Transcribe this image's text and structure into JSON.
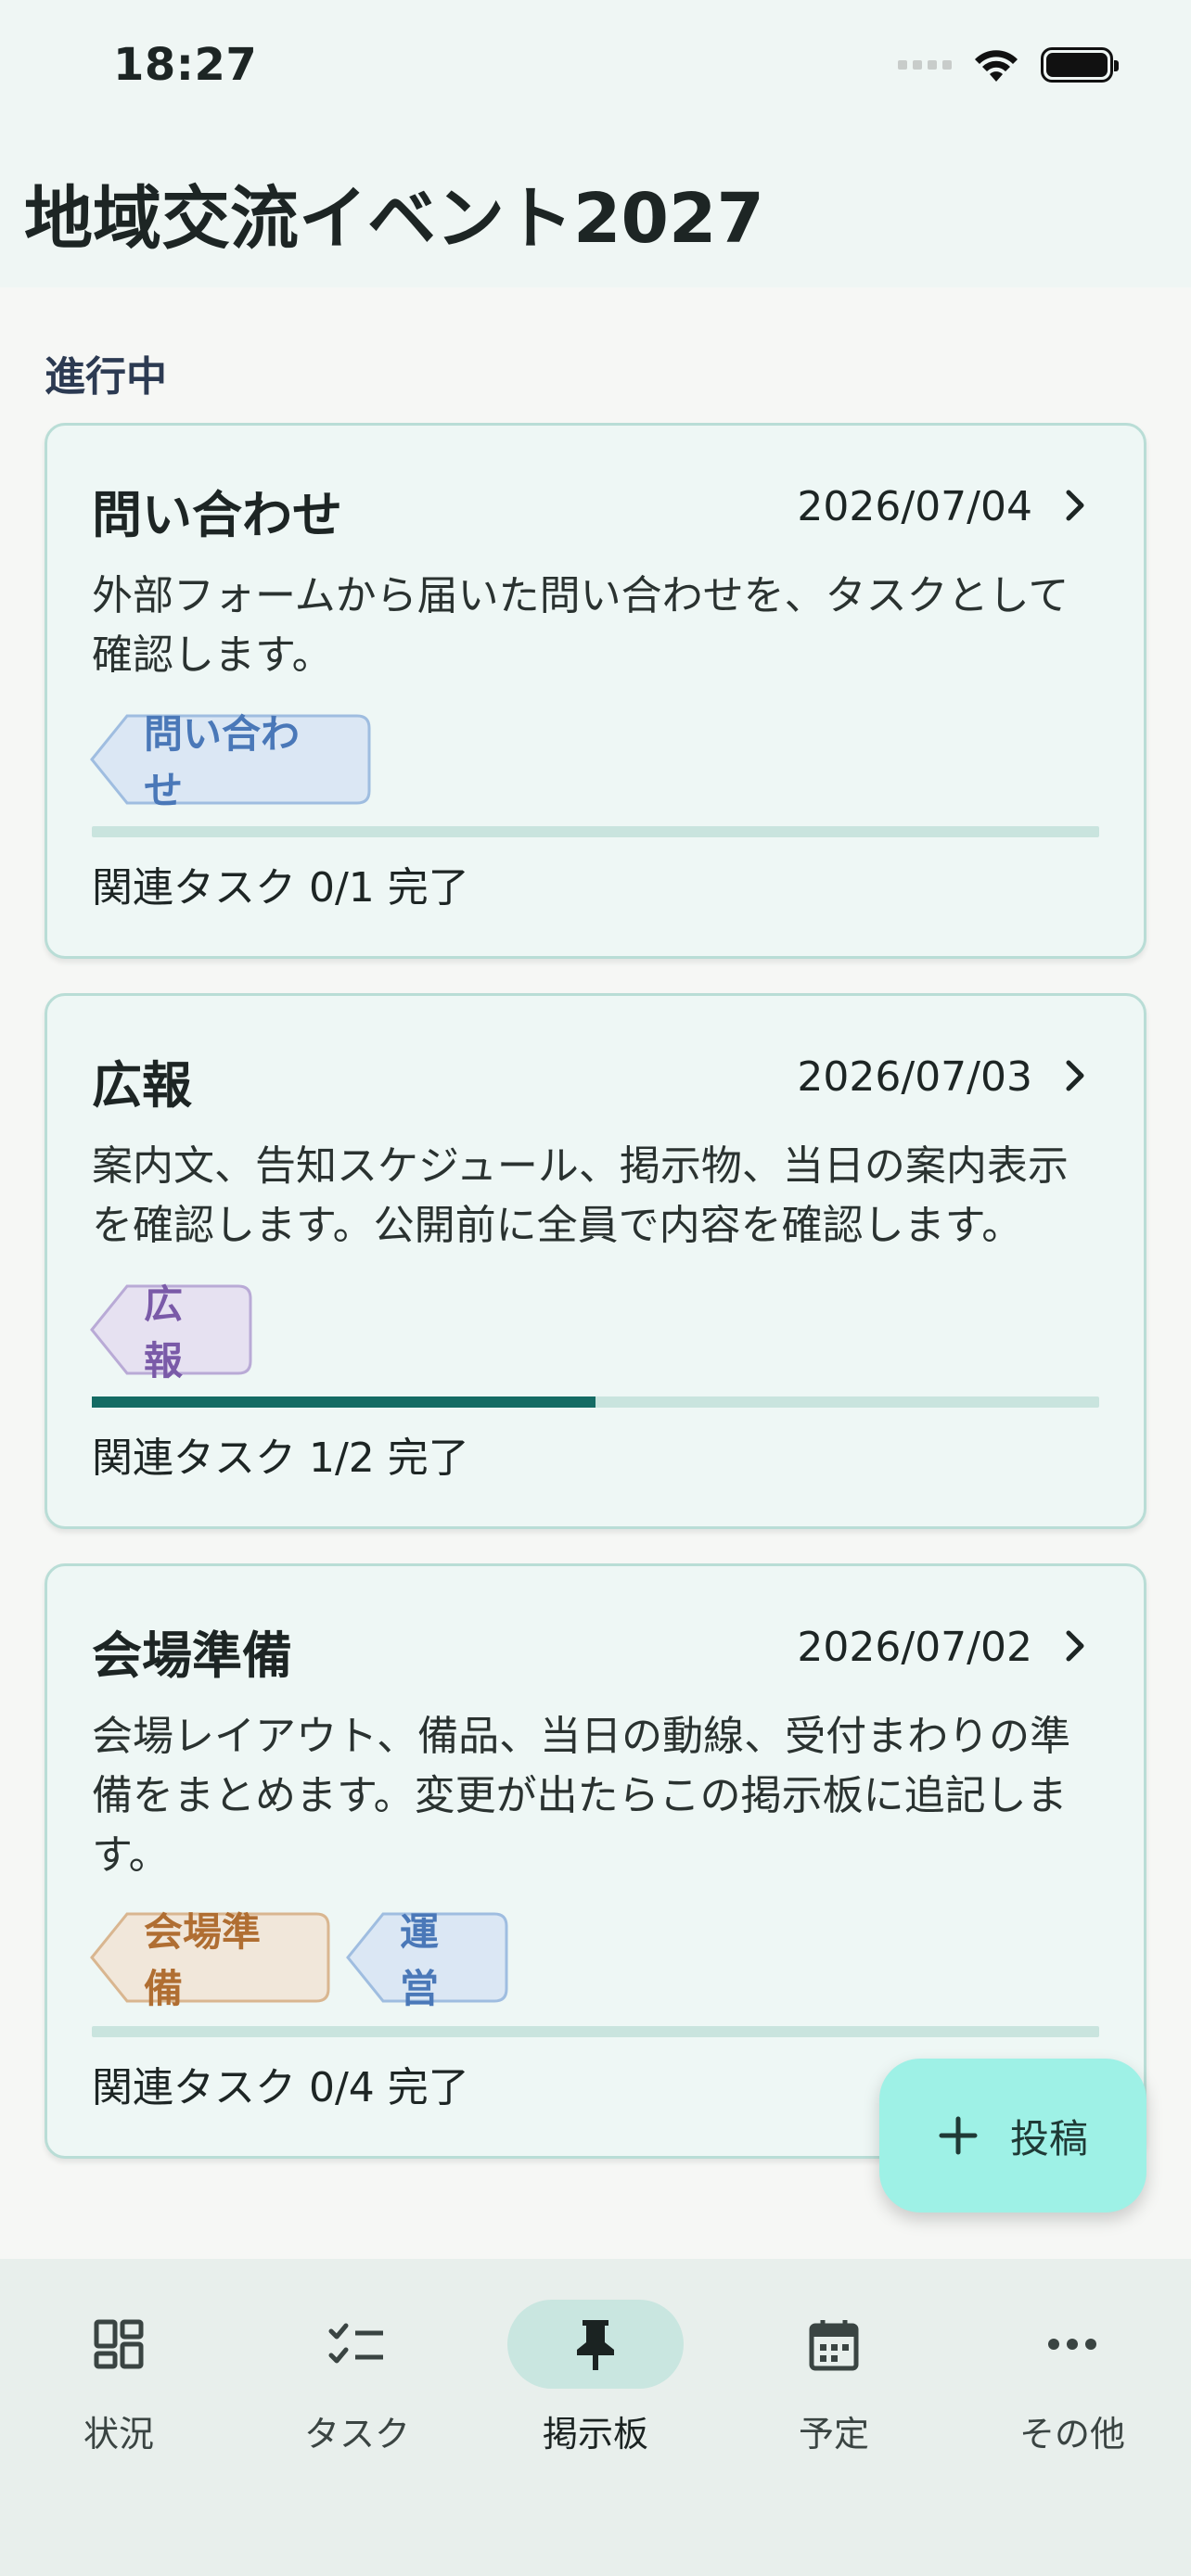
{
  "status_bar": {
    "time": "18:27"
  },
  "app": {
    "title": "地域交流イベント2027"
  },
  "section": {
    "label": "進行中"
  },
  "cards": [
    {
      "title": "問い合わせ",
      "date": "2026/07/04",
      "body": "外部フォームから届いた問い合わせを、タスクとして確認します。",
      "tags": [
        {
          "label": "問い合わせ",
          "color": "#4a78b8",
          "bg": "#dbe7f4",
          "border": "#9fbde0"
        }
      ],
      "progress": 0,
      "count": "関連タスク 0/1 完了"
    },
    {
      "title": "広報",
      "date": "2026/07/03",
      "body": "案内文、告知スケジュール、掲示物、当日の案内表示を確認します。公開前に全員で内容を確認します。",
      "tags": [
        {
          "label": "広報",
          "color": "#7a5aa8",
          "bg": "#e6e1f1",
          "border": "#b9aad6"
        }
      ],
      "progress": 0.5,
      "count": "関連タスク 1/2 完了"
    },
    {
      "title": "会場準備",
      "date": "2026/07/02",
      "body": "会場レイアウト、備品、当日の動線、受付まわりの準備をまとめます。変更が出たらこの掲示板に追記します。",
      "tags": [
        {
          "label": "会場準備",
          "color": "#b06e32",
          "bg": "#f1e7da",
          "border": "#d9b690"
        },
        {
          "label": "運営",
          "color": "#4a78b8",
          "bg": "#dbe7f4",
          "border": "#9fbde0"
        }
      ],
      "progress": 0,
      "count": "関連タスク 0/4 完了"
    }
  ],
  "fab": {
    "label": "投稿",
    "icon": "plus-icon"
  },
  "nav": [
    {
      "label": "状況",
      "icon": "dashboard-icon",
      "active": false
    },
    {
      "label": "タスク",
      "icon": "checklist-icon",
      "active": false
    },
    {
      "label": "掲示板",
      "icon": "pin-icon",
      "active": true
    },
    {
      "label": "予定",
      "icon": "calendar-icon",
      "active": false
    },
    {
      "label": "その他",
      "icon": "more-icon",
      "active": false
    }
  ],
  "colors": {
    "accent": "#146b64",
    "fab": "#9ef1e6",
    "card_bg": "#eef7f5",
    "card_border": "#b9ddd6"
  }
}
